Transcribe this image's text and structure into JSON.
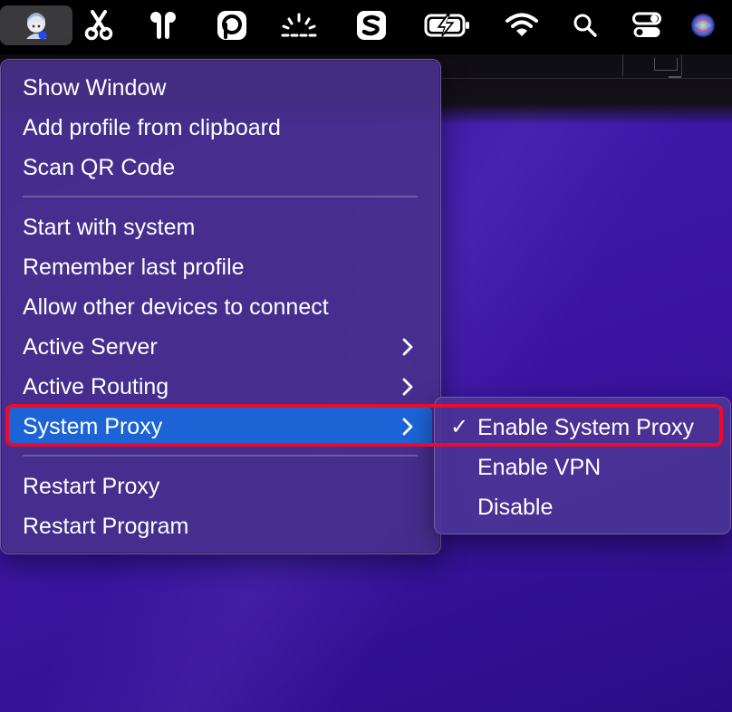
{
  "menubar": {
    "icons": [
      "app-avatar-icon",
      "scissors-icon",
      "airpods-icon",
      "p-circle-app-icon",
      "brightness-icon",
      "s-app-icon",
      "battery-charging-icon",
      "wifi-icon",
      "search-icon",
      "control-center-icon",
      "siri-icon"
    ]
  },
  "menu": {
    "items": [
      {
        "label": "Show Window"
      },
      {
        "label": "Add profile from clipboard"
      },
      {
        "label": "Scan QR Code"
      },
      {
        "label": "Start with system"
      },
      {
        "label": "Remember last profile"
      },
      {
        "label": "Allow other devices to connect"
      },
      {
        "label": "Active Server",
        "submenu": true
      },
      {
        "label": "Active Routing",
        "submenu": true
      },
      {
        "label": "System Proxy",
        "submenu": true,
        "highlighted": true
      },
      {
        "label": "Restart Proxy"
      },
      {
        "label": "Restart Program"
      }
    ]
  },
  "submenu": {
    "items": [
      {
        "label": "Enable System Proxy",
        "checked": true,
        "check_glyph": "✓"
      },
      {
        "label": "Enable VPN"
      },
      {
        "label": "Disable"
      }
    ]
  },
  "colors": {
    "highlight": "#1c64d6",
    "annotation": "#ee0a2a",
    "menu_bg": "#48308c",
    "wallpaper": "#3d18a8"
  }
}
